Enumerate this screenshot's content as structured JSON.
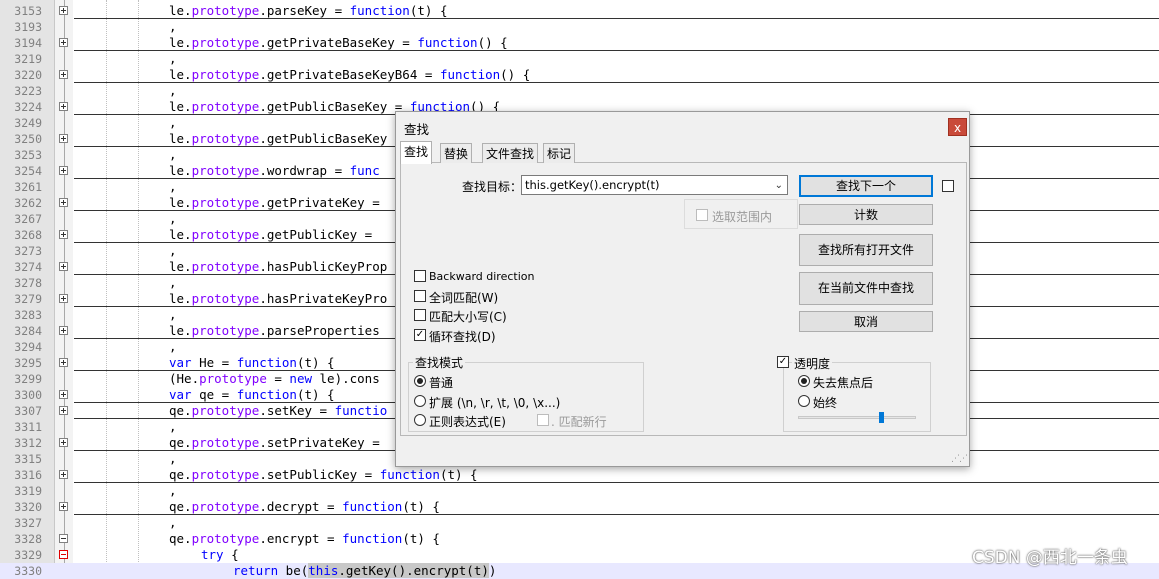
{
  "editor": {
    "lines": [
      {
        "num": "3153",
        "fold": "open",
        "sep": true,
        "segs": [
          [
            "plain",
            "le."
          ],
          [
            "prop",
            "prototype"
          ],
          [
            "plain",
            ".parseKey = "
          ],
          [
            "kw",
            "function"
          ],
          [
            "plain",
            "(t) {"
          ]
        ]
      },
      {
        "num": "3193",
        "fold": "",
        "sep": false,
        "segs": [
          [
            "plain",
            ","
          ]
        ]
      },
      {
        "num": "3194",
        "fold": "open",
        "sep": true,
        "segs": [
          [
            "plain",
            "le."
          ],
          [
            "prop",
            "prototype"
          ],
          [
            "plain",
            ".getPrivateBaseKey = "
          ],
          [
            "kw",
            "function"
          ],
          [
            "plain",
            "() {"
          ]
        ]
      },
      {
        "num": "3219",
        "fold": "",
        "sep": false,
        "segs": [
          [
            "plain",
            ","
          ]
        ]
      },
      {
        "num": "3220",
        "fold": "open",
        "sep": true,
        "segs": [
          [
            "plain",
            "le."
          ],
          [
            "prop",
            "prototype"
          ],
          [
            "plain",
            ".getPrivateBaseKeyB64 = "
          ],
          [
            "kw",
            "function"
          ],
          [
            "plain",
            "() {"
          ]
        ]
      },
      {
        "num": "3223",
        "fold": "",
        "sep": false,
        "segs": [
          [
            "plain",
            ","
          ]
        ]
      },
      {
        "num": "3224",
        "fold": "open",
        "sep": true,
        "segs": [
          [
            "plain",
            "le."
          ],
          [
            "prop",
            "prototype"
          ],
          [
            "plain",
            ".getPublicBaseKey = "
          ],
          [
            "kw",
            "function"
          ],
          [
            "plain",
            "() {"
          ]
        ]
      },
      {
        "num": "3249",
        "fold": "",
        "sep": false,
        "segs": [
          [
            "plain",
            ","
          ]
        ]
      },
      {
        "num": "3250",
        "fold": "open",
        "sep": true,
        "segs": [
          [
            "plain",
            "le."
          ],
          [
            "prop",
            "prototype"
          ],
          [
            "plain",
            ".getPublicBaseKey"
          ]
        ]
      },
      {
        "num": "3253",
        "fold": "",
        "sep": false,
        "segs": [
          [
            "plain",
            ","
          ]
        ]
      },
      {
        "num": "3254",
        "fold": "open",
        "sep": true,
        "segs": [
          [
            "plain",
            "le."
          ],
          [
            "prop",
            "prototype"
          ],
          [
            "plain",
            ".wordwrap = "
          ],
          [
            "kw",
            "func"
          ]
        ]
      },
      {
        "num": "3261",
        "fold": "",
        "sep": false,
        "segs": [
          [
            "plain",
            ","
          ]
        ]
      },
      {
        "num": "3262",
        "fold": "open",
        "sep": true,
        "segs": [
          [
            "plain",
            "le."
          ],
          [
            "prop",
            "prototype"
          ],
          [
            "plain",
            ".getPrivateKey = "
          ]
        ]
      },
      {
        "num": "3267",
        "fold": "",
        "sep": false,
        "segs": [
          [
            "plain",
            ","
          ]
        ]
      },
      {
        "num": "3268",
        "fold": "open",
        "sep": true,
        "segs": [
          [
            "plain",
            "le."
          ],
          [
            "prop",
            "prototype"
          ],
          [
            "plain",
            ".getPublicKey = "
          ]
        ]
      },
      {
        "num": "3273",
        "fold": "",
        "sep": false,
        "segs": [
          [
            "plain",
            ","
          ]
        ]
      },
      {
        "num": "3274",
        "fold": "open",
        "sep": true,
        "segs": [
          [
            "plain",
            "le."
          ],
          [
            "prop",
            "prototype"
          ],
          [
            "plain",
            ".hasPublicKeyProp"
          ]
        ]
      },
      {
        "num": "3278",
        "fold": "",
        "sep": false,
        "segs": [
          [
            "plain",
            ","
          ]
        ]
      },
      {
        "num": "3279",
        "fold": "open",
        "sep": true,
        "segs": [
          [
            "plain",
            "le."
          ],
          [
            "prop",
            "prototype"
          ],
          [
            "plain",
            ".hasPrivateKeyPro"
          ]
        ]
      },
      {
        "num": "3283",
        "fold": "",
        "sep": false,
        "segs": [
          [
            "plain",
            ","
          ]
        ]
      },
      {
        "num": "3284",
        "fold": "open",
        "sep": true,
        "segs": [
          [
            "plain",
            "le."
          ],
          [
            "prop",
            "prototype"
          ],
          [
            "plain",
            ".parseProperties"
          ]
        ]
      },
      {
        "num": "3294",
        "fold": "",
        "sep": false,
        "segs": [
          [
            "plain",
            ","
          ]
        ]
      },
      {
        "num": "3295",
        "fold": "open",
        "sep": true,
        "segs": [
          [
            "kw",
            "var"
          ],
          [
            "plain",
            " He = "
          ],
          [
            "kw",
            "function"
          ],
          [
            "plain",
            "(t) {"
          ]
        ]
      },
      {
        "num": "3299",
        "fold": "",
        "sep": false,
        "segs": [
          [
            "plain",
            "(He."
          ],
          [
            "prop",
            "prototype"
          ],
          [
            "plain",
            " = "
          ],
          [
            "kw",
            "new"
          ],
          [
            "plain",
            " le).cons"
          ]
        ]
      },
      {
        "num": "3300",
        "fold": "open",
        "sep": true,
        "segs": [
          [
            "kw",
            "var"
          ],
          [
            "plain",
            " qe = "
          ],
          [
            "kw",
            "function"
          ],
          [
            "plain",
            "(t) {"
          ]
        ]
      },
      {
        "num": "3307",
        "fold": "open",
        "sep": true,
        "segs": [
          [
            "plain",
            "qe."
          ],
          [
            "prop",
            "prototype"
          ],
          [
            "plain",
            ".setKey = "
          ],
          [
            "kw",
            "functio"
          ]
        ]
      },
      {
        "num": "3311",
        "fold": "",
        "sep": false,
        "segs": [
          [
            "plain",
            ","
          ]
        ]
      },
      {
        "num": "3312",
        "fold": "open",
        "sep": true,
        "segs": [
          [
            "plain",
            "qe."
          ],
          [
            "prop",
            "prototype"
          ],
          [
            "plain",
            ".setPrivateKey = "
          ]
        ]
      },
      {
        "num": "3315",
        "fold": "",
        "sep": false,
        "segs": [
          [
            "plain",
            ","
          ]
        ]
      },
      {
        "num": "3316",
        "fold": "open",
        "sep": true,
        "segs": [
          [
            "plain",
            "qe."
          ],
          [
            "prop",
            "prototype"
          ],
          [
            "plain",
            ".setPublicKey = "
          ],
          [
            "kw",
            "function"
          ],
          [
            "plain",
            "(t) {"
          ]
        ]
      },
      {
        "num": "3319",
        "fold": "",
        "sep": false,
        "segs": [
          [
            "plain",
            ","
          ]
        ]
      },
      {
        "num": "3320",
        "fold": "open",
        "sep": true,
        "segs": [
          [
            "plain",
            "qe."
          ],
          [
            "prop",
            "prototype"
          ],
          [
            "plain",
            ".decrypt = "
          ],
          [
            "kw",
            "function"
          ],
          [
            "plain",
            "(t) {"
          ]
        ]
      },
      {
        "num": "3327",
        "fold": "",
        "sep": false,
        "segs": [
          [
            "plain",
            ","
          ]
        ]
      },
      {
        "num": "3328",
        "fold": "closed",
        "sep": false,
        "segs": [
          [
            "plain",
            "qe."
          ],
          [
            "prop",
            "prototype"
          ],
          [
            "plain",
            ".encrypt = "
          ],
          [
            "kw",
            "function"
          ],
          [
            "plain",
            "(t) {"
          ]
        ]
      },
      {
        "num": "3329",
        "fold": "red",
        "sep": false,
        "indent": 2,
        "segs": [
          [
            "kw",
            "try"
          ],
          [
            "plain",
            " {"
          ]
        ]
      },
      {
        "num": "3330",
        "fold": "",
        "sep": false,
        "indent": 3,
        "current": true,
        "segs": [
          [
            "kw",
            "return"
          ],
          [
            "plain",
            " be("
          ],
          [
            "kwhl",
            "this"
          ],
          [
            "hl",
            ".getKey().encrypt(t)"
          ],
          [
            "plain",
            ")"
          ]
        ]
      }
    ]
  },
  "find_dialog": {
    "title": "查找",
    "close_label": "x",
    "tabs": [
      "查找",
      "替换",
      "文件查找",
      "标记"
    ],
    "search_label": "查找目标：",
    "search_value": "this.getKey().encrypt(t)",
    "in_selection_label": "选取范围内",
    "buttons": {
      "find_next": "查找下一个",
      "count": "计数",
      "find_all_open": "查找所有打开文件",
      "find_all_current": "在当前文件中查找",
      "cancel": "取消"
    },
    "options": {
      "backward": "Backward direction",
      "whole_word": "全词匹配(W)",
      "match_case": "匹配大小写(C)",
      "wrap": "循环查找(D)"
    },
    "search_mode": {
      "title": "查找模式",
      "normal": "普通",
      "extended": "扩展 (\\n, \\r, \\t, \\0, \\x...)",
      "regex": "正则表达式(E)",
      "dot_newline": ". 匹配新行"
    },
    "transparency": {
      "title": "透明度",
      "on_lose_focus": "失去焦点后",
      "always": "始终",
      "level": 0.7
    }
  },
  "watermark": "CSDN @西北一条虫"
}
